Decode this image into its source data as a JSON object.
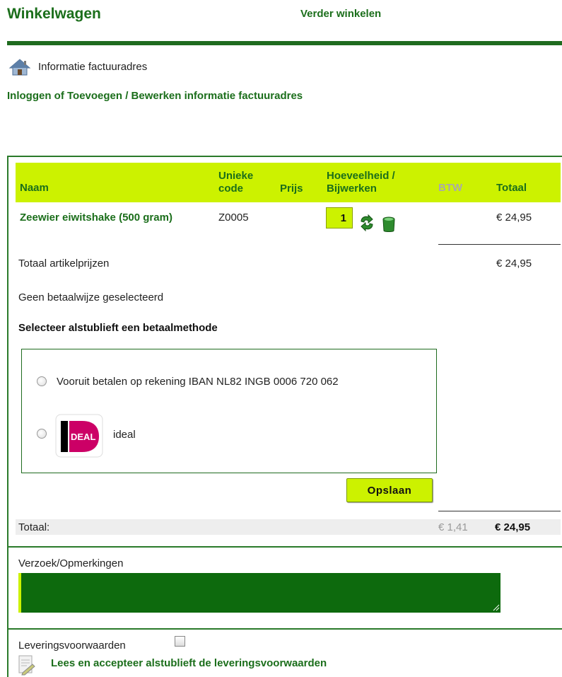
{
  "header": {
    "title": "Winkelwagen",
    "continue_shopping": "Verder winkelen"
  },
  "billing": {
    "info_label": "Informatie factuuradres",
    "login_link": "Inloggen of Toevoegen / Bewerken informatie factuuradres",
    "icon": "house-icon"
  },
  "cart": {
    "columns": {
      "naam": "Naam",
      "code": "Unieke code",
      "prijs": "Prijs",
      "hoeveelheid": "Hoeveelheid / Bijwerken",
      "btw": "BTW",
      "totaal": "Totaal"
    },
    "items": [
      {
        "name": "Zeewier eiwitshake (500 gram)",
        "code": "Z0005",
        "quantity": "1",
        "total": "€ 24,95"
      }
    ],
    "subtotal_label": "Totaal artikelprijzen",
    "subtotal_value": "€ 24,95"
  },
  "payment": {
    "none_selected": "Geen betaalwijze geselecteerd",
    "prompt": "Selecteer alstublieft een betaalmethode",
    "options": [
      {
        "label": "Vooruit betalen op rekening IBAN NL82 INGB 0006 720 062"
      },
      {
        "label": "ideal",
        "logo_text": "iDEAL"
      }
    ],
    "save_button": "Opslaan"
  },
  "totals": {
    "label": "Totaal:",
    "btw": "€ 1,41",
    "total": "€ 24,95"
  },
  "remarks": {
    "label": "Verzoek/Opmerkingen"
  },
  "terms": {
    "label": "Leveringsvoorwaarden",
    "link": "Lees en accepteer alstublieft de leveringsvoorwaarden"
  },
  "colors": {
    "brand_green": "#1b6e1b",
    "accent_lime": "#ccf200",
    "remarks_bg": "#0d6a0d",
    "ideal_pink": "#cc0066"
  }
}
